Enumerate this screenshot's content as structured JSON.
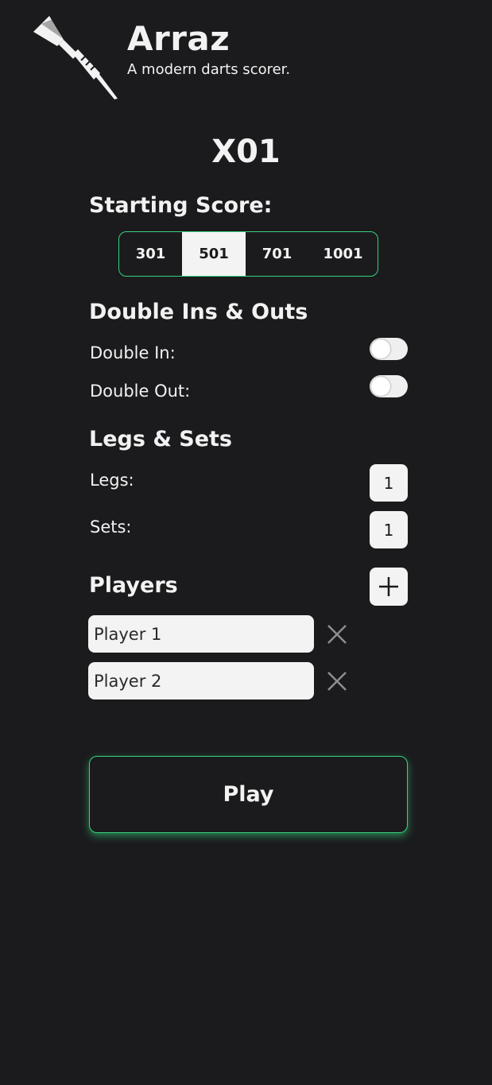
{
  "header": {
    "title": "Arraz",
    "subtitle": "A modern darts scorer."
  },
  "game": {
    "title": "X01"
  },
  "starting_score": {
    "label": "Starting Score:",
    "options": [
      "301",
      "501",
      "701",
      "1001"
    ],
    "selected": "501"
  },
  "doubles": {
    "heading": "Double Ins & Outs",
    "double_in_label": "Double In:",
    "double_in_on": false,
    "double_out_label": "Double Out:",
    "double_out_on": false
  },
  "legs_sets": {
    "heading": "Legs & Sets",
    "legs_label": "Legs:",
    "legs_value": "1",
    "sets_label": "Sets:",
    "sets_value": "1"
  },
  "players": {
    "heading": "Players",
    "list": [
      "Player 1",
      "Player 2"
    ]
  },
  "play_button": {
    "label": "Play"
  },
  "colors": {
    "background": "#1b1b1d",
    "accent": "#37d27e",
    "light": "#f3f3f3"
  },
  "icons": {
    "logo": "dart-icon",
    "add": "plus-icon",
    "remove": "close-icon"
  }
}
